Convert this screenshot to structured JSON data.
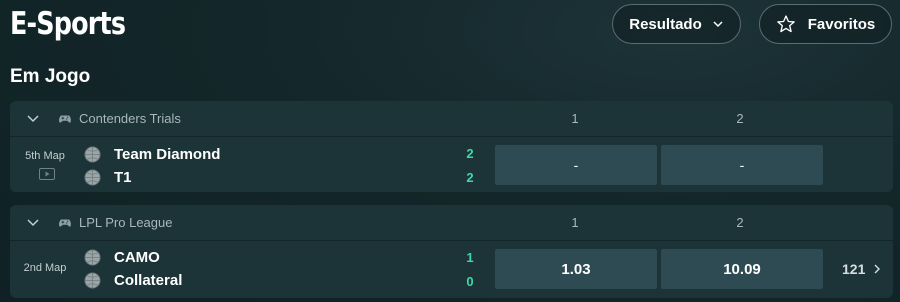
{
  "header": {
    "title": "E-Sports",
    "result_button": "Resultado",
    "favorites_button": "Favoritos"
  },
  "section": {
    "title": "Em Jogo"
  },
  "events": [
    {
      "league": "Contenders Trials",
      "columns": [
        "1",
        "2"
      ],
      "map": "5th Map",
      "teams": [
        {
          "name": "Team Diamond",
          "score": "2"
        },
        {
          "name": "T1",
          "score": "2"
        }
      ],
      "odds": [
        "-",
        "-"
      ],
      "more_markets": ""
    },
    {
      "league": "LPL Pro League",
      "columns": [
        "1",
        "2"
      ],
      "map": "2nd Map",
      "teams": [
        {
          "name": "CAMO",
          "score": "1"
        },
        {
          "name": "Collateral",
          "score": "0"
        }
      ],
      "odds": [
        "1.03",
        "10.09"
      ],
      "more_markets": "121"
    }
  ],
  "colors": {
    "background": "#132629",
    "card": "#1c3337",
    "odd_button": "#2e4b53",
    "score": "#3fd8a8"
  },
  "icons": [
    "chevron-down-icon",
    "star-icon",
    "gamepad-icon",
    "play-icon",
    "ball-icon",
    "chevron-right-icon"
  ]
}
